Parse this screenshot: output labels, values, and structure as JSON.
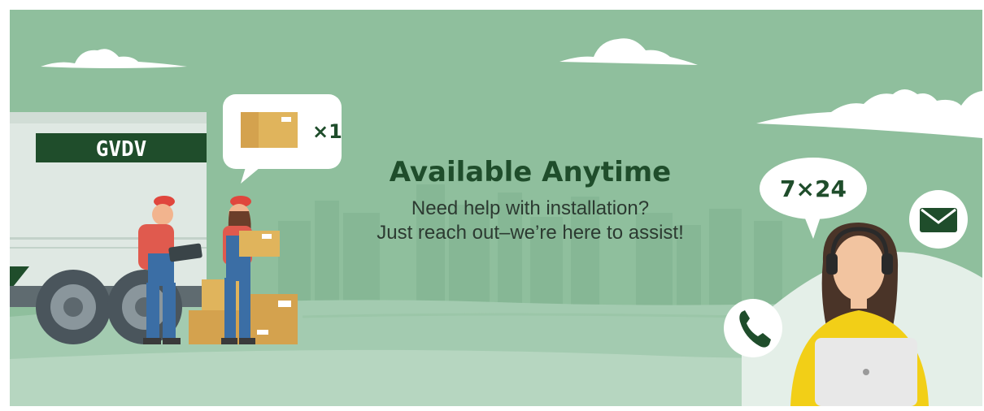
{
  "banner": {
    "truck_brand": "GVDV",
    "package_count": "×1",
    "availability_badge": "7×24",
    "title": "Available Anytime",
    "subtitle_line1": "Need help with installation?",
    "subtitle_line2": "Just reach out–we’re here to assist!"
  },
  "colors": {
    "background": "#8fbf9d",
    "brand_green": "#1f4d2b",
    "accent_yellow": "#f2cf17",
    "hat_red": "#e0463d",
    "box": "#d4a24e"
  },
  "icons": [
    "phone-icon",
    "mail-icon",
    "box-icon",
    "headset-icon",
    "laptop-icon"
  ]
}
